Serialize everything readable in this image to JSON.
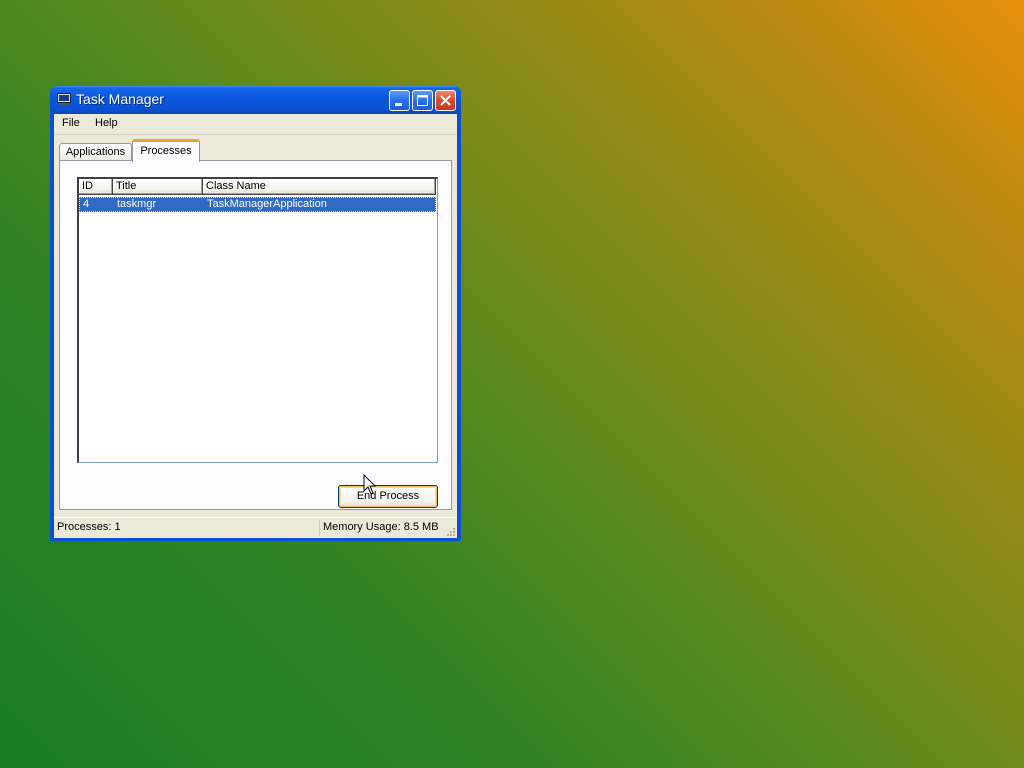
{
  "window": {
    "title": "Task Manager"
  },
  "menu": {
    "file": "File",
    "help": "Help"
  },
  "tabs": [
    {
      "label": "Applications"
    },
    {
      "label": "Processes"
    }
  ],
  "list": {
    "columns": [
      "ID",
      "Title",
      "Class Name"
    ],
    "rows": [
      {
        "id": "4",
        "title": "taskmgr",
        "class_name": "TaskManagerApplication"
      }
    ]
  },
  "buttons": {
    "end_process": "End Process"
  },
  "statusbar": {
    "processes": "Processes: 1",
    "memory": "Memory Usage: 8.5 MB"
  },
  "icons": {
    "app": "monitor-icon",
    "minimize": "minimize-icon",
    "maximize": "maximize-icon",
    "close": "close-icon"
  },
  "colors": {
    "titlebar": "#0a52d4",
    "selection": "#316ac5",
    "close_button": "#dc4a2a"
  }
}
